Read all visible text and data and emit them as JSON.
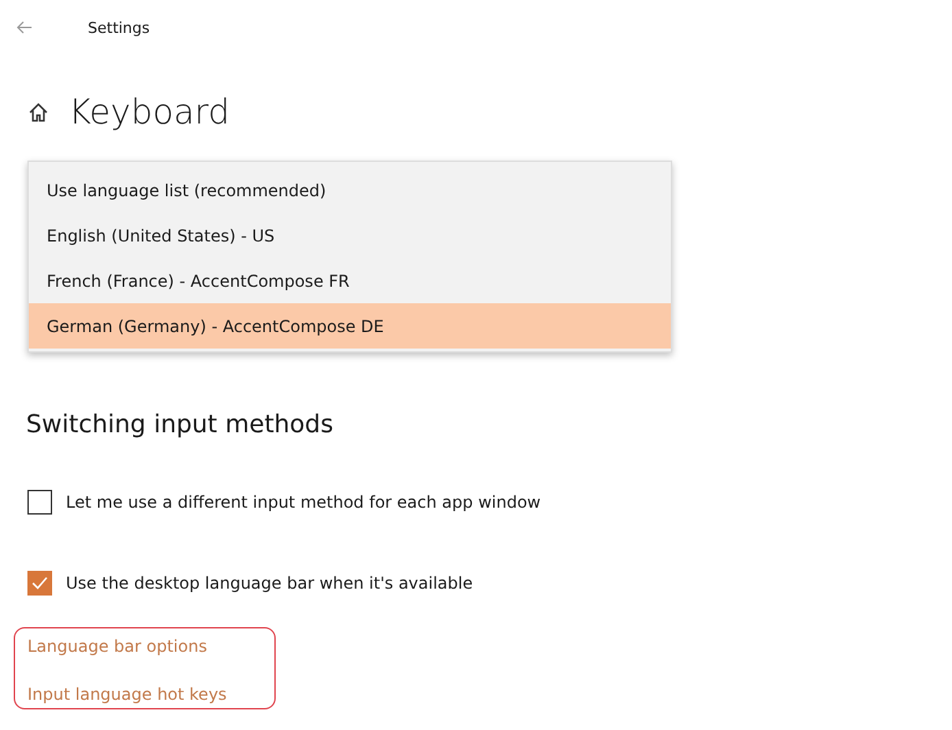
{
  "window": {
    "title": "Settings"
  },
  "page": {
    "title": "Keyboard"
  },
  "dropdown": {
    "options": [
      {
        "label": "Use language list (recommended)",
        "selected": false
      },
      {
        "label": "English (United States) - US",
        "selected": false
      },
      {
        "label": "French (France) - AccentCompose FR",
        "selected": false
      },
      {
        "label": "German (Germany) - AccentCompose DE",
        "selected": true
      }
    ]
  },
  "section": {
    "title": "Switching input methods",
    "checkboxes": [
      {
        "label": "Let me use a different input method for each app window",
        "checked": false
      },
      {
        "label": "Use the desktop language bar when it's available",
        "checked": true
      }
    ],
    "links": [
      "Language bar options",
      "Input language hot keys"
    ]
  }
}
